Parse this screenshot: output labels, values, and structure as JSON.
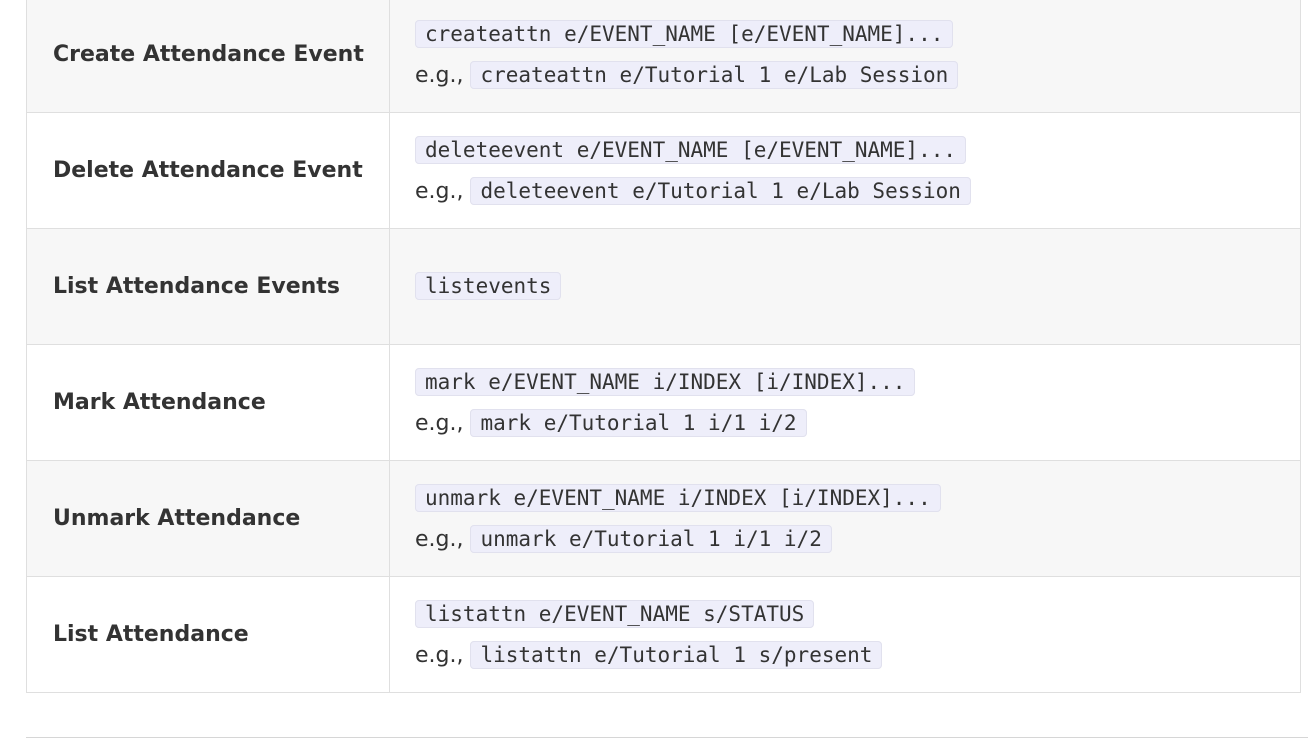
{
  "commands": [
    {
      "action": "Create Attendance Event",
      "format": "createattn e/EVENT_NAME [e/EVENT_NAME]...",
      "example_label": "e.g.,",
      "example": "createattn e/Tutorial 1 e/Lab Session"
    },
    {
      "action": "Delete Attendance Event",
      "format": "deleteevent e/EVENT_NAME [e/EVENT_NAME]...",
      "example_label": "e.g.,",
      "example": "deleteevent e/Tutorial 1 e/Lab Session"
    },
    {
      "action": "List Attendance Events",
      "format": "listevents",
      "example_label": "",
      "example": ""
    },
    {
      "action": "Mark Attendance",
      "format": "mark e/EVENT_NAME i/INDEX [i/INDEX]...",
      "example_label": "e.g.,",
      "example": "mark e/Tutorial 1 i/1 i/2"
    },
    {
      "action": "Unmark Attendance",
      "format": "unmark e/EVENT_NAME i/INDEX [i/INDEX]...",
      "example_label": "e.g.,",
      "example": "unmark e/Tutorial 1 i/1 i/2"
    },
    {
      "action": "List Attendance",
      "format": "listattn e/EVENT_NAME s/STATUS",
      "example_label": "e.g.,",
      "example": "listattn e/Tutorial 1 s/present"
    }
  ]
}
